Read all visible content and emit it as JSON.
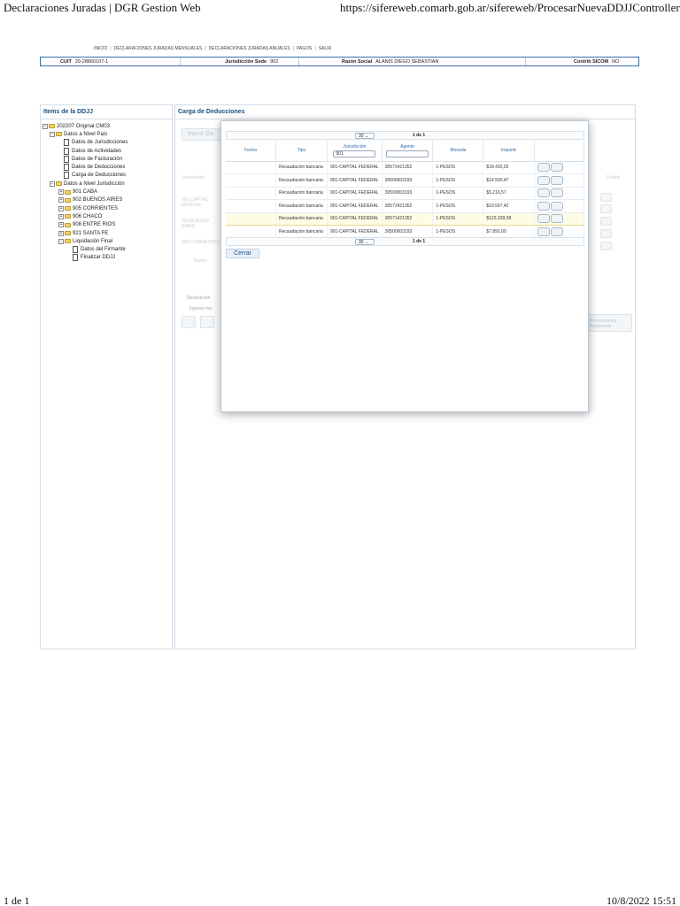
{
  "print": {
    "page_title": "Declaraciones Juradas | DGR Gestion Web",
    "url": "https://sifereweb.comarb.gob.ar/sifereweb/ProcesarNuevaDDJJController.do",
    "page_count": "1 de 1",
    "datetime": "10/8/2022 15:51"
  },
  "menu": [
    "INICIO",
    "DECLARACIONES JURADAS MENSUALES",
    "DECLARACIONES JURADAS ANUALES",
    "PAGOS",
    "SALIR"
  ],
  "info": {
    "cuit_label": "CUIT",
    "cuit_value": "20-28860107-1",
    "jur_label": "Jurisdicción Sede",
    "jur_value": "902",
    "razon_label": "Razón Social",
    "razon_value": "ALANIS DIEGO SEBASTIAN",
    "sicom_label": "Contrib SICOM",
    "sicom_value": "NO"
  },
  "left_panel": {
    "title": "Items de la DDJJ",
    "tree": {
      "root": "202207 Original CM03",
      "nivel_pais": "Datos a Nivel País",
      "jurisdicciones": "Datos de Jurisdicciones",
      "actividades": "Datos de Actividades",
      "facturacion": "Datos de Facturación",
      "deducciones": "Datos de Deducciones",
      "carga_deducciones": "Carga de Deducciones",
      "nivel_jurisdiccion": "Datos a Nivel Jurisdicción",
      "j901": "901 CABA",
      "j902": "902 BUENOS AIRES",
      "j905": "905 CORRIENTES",
      "j906": "906 CHACO",
      "j908": "908 ENTRE RIOS",
      "j921": "921 SANTA FE",
      "liquidacion": "Liquidación Final",
      "firmante": "Datos del Firmante",
      "finalizar": "Finalizar DDJJ"
    }
  },
  "right_panel": {
    "title": "Carga de Deducciones",
    "bg": {
      "inicio_btn": "Inicio De",
      "jurisdiccion": "Jurisdicción",
      "detalle": "Detalle",
      "j901": "901-CAPITAL FEDERAL",
      "j902": "902-BUENOS AIRES",
      "j905": "905-CORRIENTES",
      "totales": "Totales",
      "declaracion": "Declaración",
      "ingreso": "Ingreso ma",
      "percepciones": "Percepciones Aduaneras"
    }
  },
  "modal": {
    "pager": {
      "page_size": "30",
      "page_info": "1 de 1"
    },
    "columns": {
      "fecha": "Fecha",
      "tipo": "Tipo",
      "jurisdiccion": "Jurisdicción",
      "agente": "Agente",
      "moneda": "Moneda",
      "importe": "Importe"
    },
    "filters": {
      "jurisdiccion": "901",
      "agente": ""
    },
    "rows": [
      {
        "fecha": "",
        "tipo": "Recaudación bancaria",
        "jurisdiccion": "901-CAPITAL FEDERAL",
        "agente": "30571421352",
        "moneda": "1-PESOS",
        "importe": "$18.432,02"
      },
      {
        "fecha": "",
        "tipo": "Recaudación bancaria",
        "jurisdiccion": "901-CAPITAL FEDERAL",
        "agente": "30500003193",
        "moneda": "1-PESOS",
        "importe": "$14.500,47"
      },
      {
        "fecha": "",
        "tipo": "Recaudación bancaria",
        "jurisdiccion": "901-CAPITAL FEDERAL",
        "agente": "30500003193",
        "moneda": "1-PESOS",
        "importe": "$5.216,57"
      },
      {
        "fecha": "",
        "tipo": "Recaudación bancaria",
        "jurisdiccion": "901-CAPITAL FEDERAL",
        "agente": "30571421352",
        "moneda": "1-PESOS",
        "importe": "$19.507,42"
      },
      {
        "fecha": "",
        "tipo": "Recaudación bancaria",
        "jurisdiccion": "901-CAPITAL FEDERAL",
        "agente": "30571421352",
        "moneda": "1-PESOS",
        "importe": "$123.339,38"
      },
      {
        "fecha": "",
        "tipo": "Recaudación bancaria",
        "jurisdiccion": "901-CAPITAL FEDERAL",
        "agente": "30500003193",
        "moneda": "1-PESOS",
        "importe": "$7.892,00"
      }
    ],
    "close_label": "Cerrar"
  }
}
